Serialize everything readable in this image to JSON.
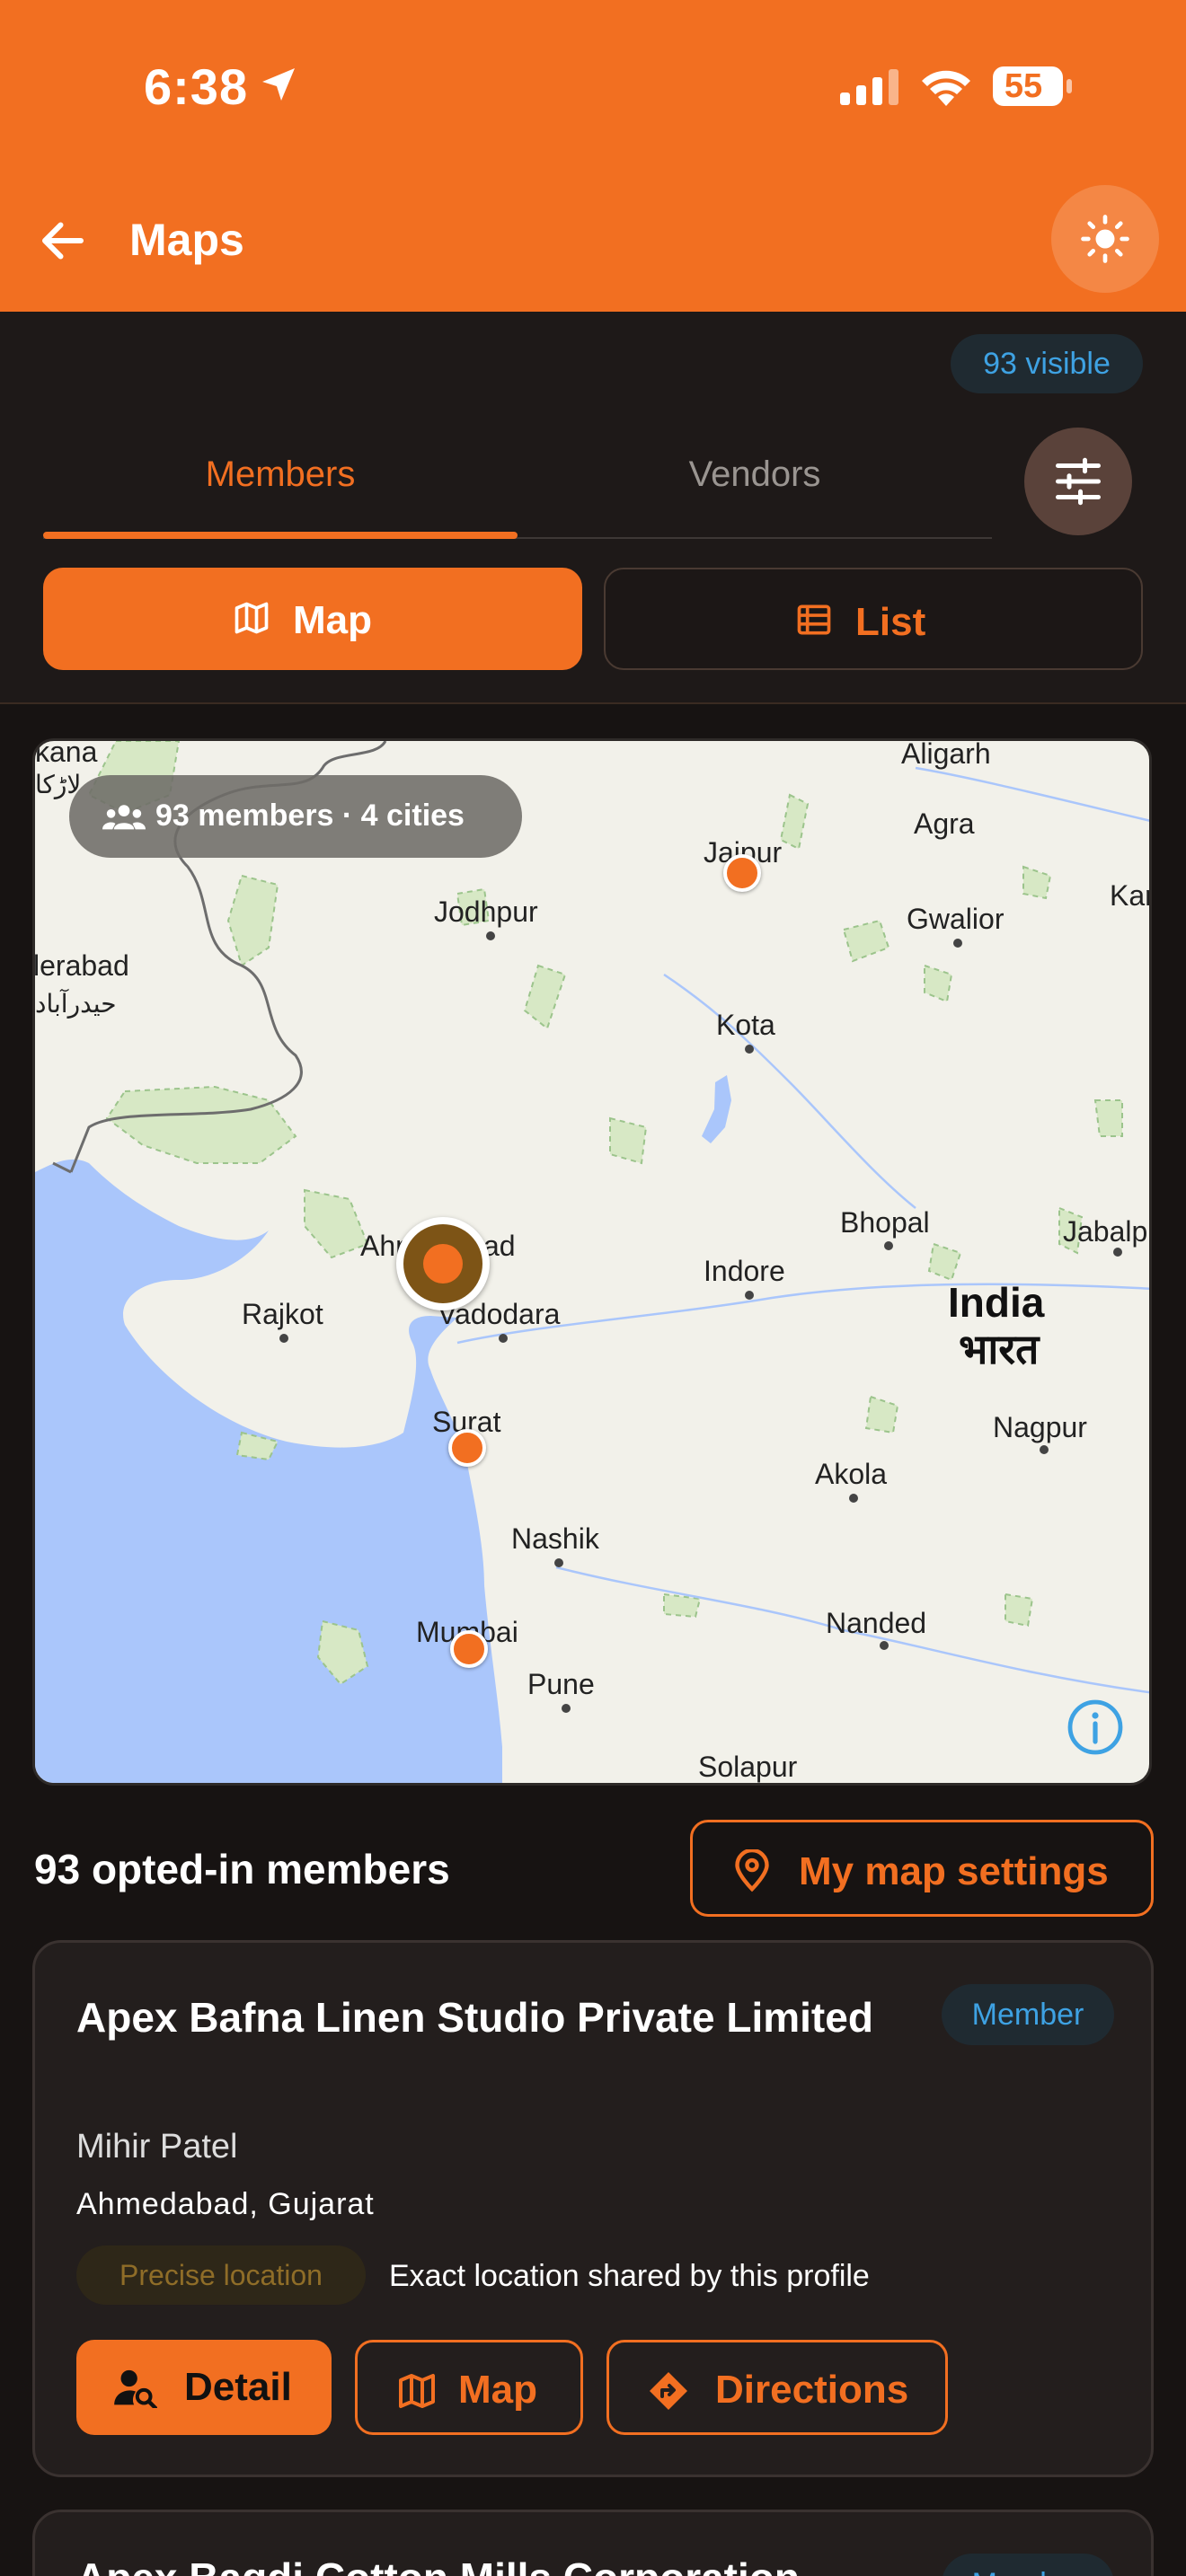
{
  "status_bar": {
    "time": "6:38",
    "battery": "55"
  },
  "header": {
    "title": "Maps"
  },
  "visible_badge": "93 visible",
  "tabs": [
    {
      "label": "Members",
      "active": true
    },
    {
      "label": "Vendors",
      "active": false
    }
  ],
  "view_toggle": {
    "map_label": "Map",
    "list_label": "List",
    "selected": "Map"
  },
  "map": {
    "summary_chip": "93 members · 4 cities",
    "labels": {
      "kana": "kana",
      "larkana_urdu": "لاڑکا",
      "hyderabad": "lerabad",
      "hyderabad_urdu": "حیدرآباد",
      "aligarh": "Aligarh",
      "agra": "Agra",
      "jaipur": "Jaipur",
      "jodhpur": "Jodhpur",
      "gwalior": "Gwalior",
      "kanpur": "Kar",
      "kota": "Kota",
      "bhopal": "Bhopal",
      "jabalpur": "Jabalp",
      "ahmedabad": "Ahmedabad",
      "rajkot": "Rajkot",
      "vadodara": "Vadodara",
      "indore": "Indore",
      "india": "India",
      "india_hindi": "भारत",
      "surat": "Surat",
      "nagpur": "Nagpur",
      "akola": "Akola",
      "nashik": "Nashik",
      "mumbai": "Mumbai",
      "nanded": "Nanded",
      "pune": "Pune",
      "solapur": "Solapur"
    },
    "marker_cities": [
      "Jaipur",
      "Ahmedabad",
      "Surat",
      "Mumbai"
    ]
  },
  "list": {
    "count_label": "93 opted-in members",
    "settings_button": "My map settings"
  },
  "cards": [
    {
      "name": "Apex Bafna Linen Studio Private Limited",
      "badge": "Member",
      "person": "Mihir Patel",
      "location": "Ahmedabad, Gujarat",
      "precision_badge": "Precise location",
      "precision_desc": "Exact location shared by this profile",
      "buttons": {
        "detail": "Detail",
        "map": "Map",
        "directions": "Directions"
      }
    },
    {
      "name": "Apex Bagdi Cotton Mills Corporation",
      "badge": "Member"
    }
  ],
  "colors": {
    "accent": "#f26f21",
    "background": "#1e1918",
    "badge_blue": "#3ea2e3"
  }
}
